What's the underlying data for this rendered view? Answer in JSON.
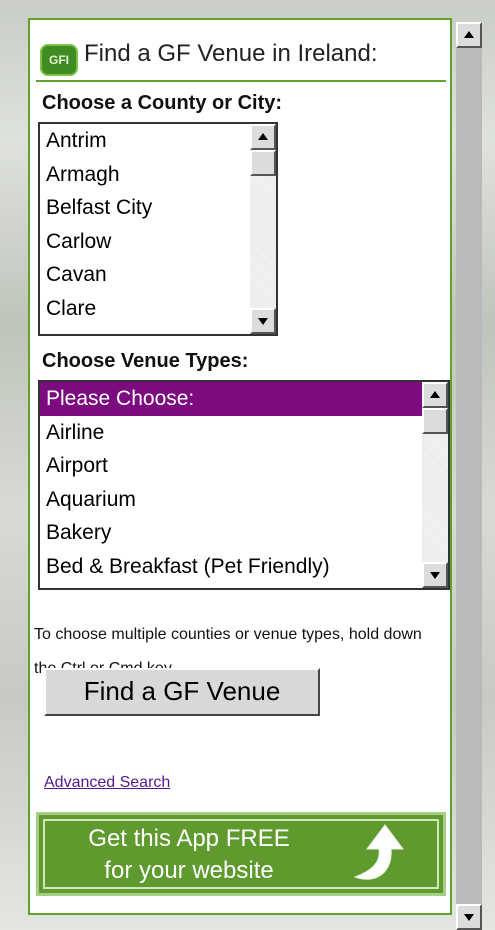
{
  "header": {
    "logo_text": "GFI",
    "title": "Find a GF Venue in Ireland:"
  },
  "county": {
    "label": "Choose a County or City:",
    "options": [
      "Antrim",
      "Armagh",
      "Belfast City",
      "Carlow",
      "Cavan",
      "Clare"
    ]
  },
  "venue": {
    "label": "Choose Venue Types:",
    "options": [
      "Please Choose:",
      "Airline",
      "Airport",
      "Aquarium",
      "Bakery",
      "Bed & Breakfast (Pet Friendly)"
    ],
    "selected_index": 0
  },
  "help_text": "To choose multiple counties or venue types, hold down the Ctrl or Cmd key.",
  "find_button": "Find a GF Venue",
  "advanced_link": "Advanced Search",
  "promo": {
    "line1": "Get this App FREE",
    "line2": "for your website"
  },
  "colors": {
    "accent_green": "#5fa32a",
    "selected_purple": "#7b0b7e",
    "promo_green": "#5e9a2e"
  }
}
